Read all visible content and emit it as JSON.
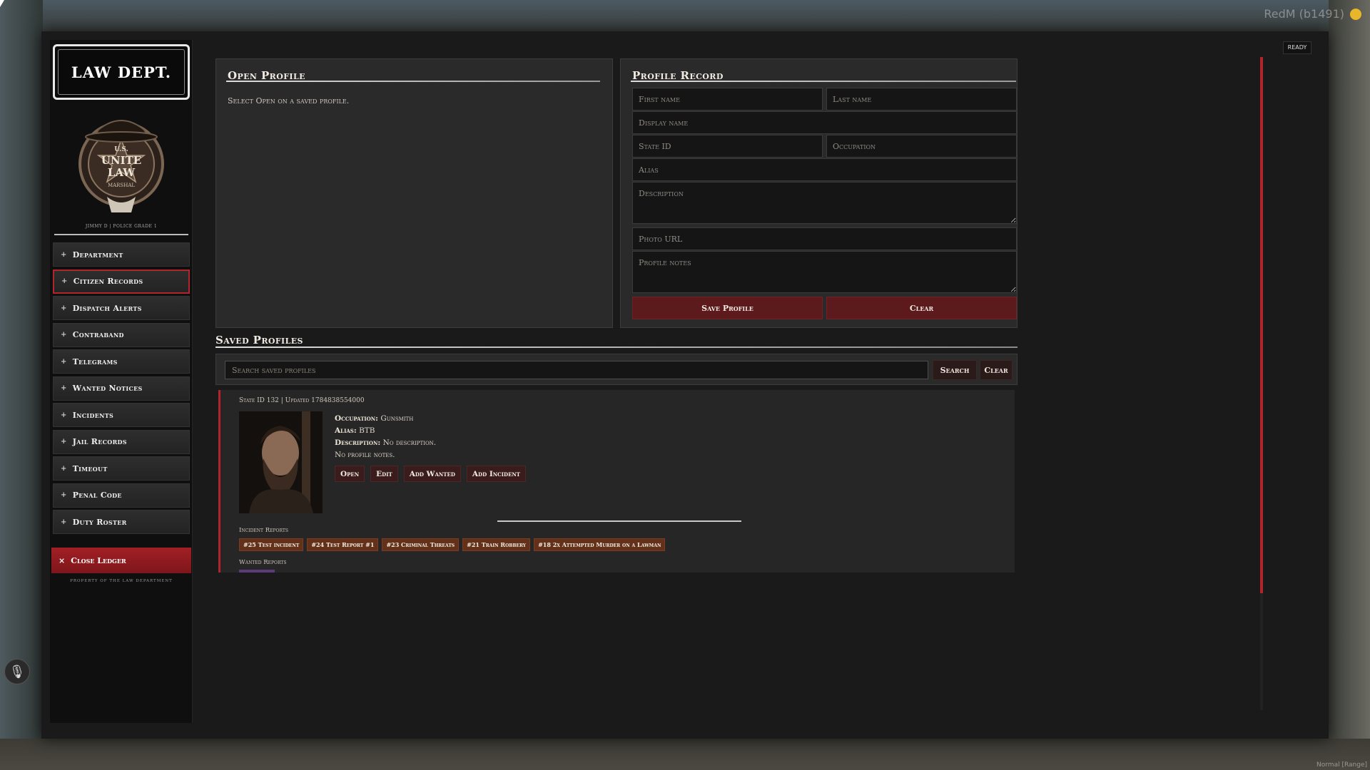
{
  "hud": {
    "top_right": "RedM (b1491)",
    "bottom_right": "Normal [Range]",
    "mic_icon": "microphone-icon"
  },
  "sidebar": {
    "logo": "LAW DEPT.",
    "badge_text": [
      "U.S.",
      "UNITE",
      "LAW",
      "MARSHAL"
    ],
    "user": "Jimmy D | Police Grade 1",
    "nav": [
      {
        "label": "Department",
        "active": false
      },
      {
        "label": "Citizen Records",
        "active": true
      },
      {
        "label": "Dispatch Alerts",
        "active": false
      },
      {
        "label": "Contraband",
        "active": false
      },
      {
        "label": "Telegrams",
        "active": false
      },
      {
        "label": "Wanted Notices",
        "active": false
      },
      {
        "label": "Incidents",
        "active": false
      },
      {
        "label": "Jail Records",
        "active": false
      },
      {
        "label": "Timeout",
        "active": false
      },
      {
        "label": "Penal Code",
        "active": false
      },
      {
        "label": "Duty Roster",
        "active": false
      }
    ],
    "close_label": "Close Ledger",
    "footer": "Property of the Law Department",
    "active_color": "#b3252c"
  },
  "status": {
    "ready": "Ready"
  },
  "open_profile": {
    "title": "Open Profile",
    "hint": "Select Open on a saved profile."
  },
  "profile_record": {
    "title": "Profile Record",
    "fields": {
      "first_name": "First name",
      "last_name": "Last name",
      "display_name": "Display name",
      "state_id": "State ID",
      "occupation": "Occupation",
      "alias": "Alias",
      "description": "Description",
      "photo_url": "Photo URL",
      "profile_notes": "Profile notes"
    },
    "save_label": "Save Profile",
    "clear_label": "Clear"
  },
  "saved_profiles": {
    "title": "Saved Profiles",
    "search_placeholder": "Search saved profiles",
    "search_label": "Search",
    "clear_label": "Clear",
    "card": {
      "meta": "State ID 132 | Updated 1784838554000",
      "occupation_label": "Occupation:",
      "occupation": "Gunsmith",
      "alias_label": "Alias:",
      "alias": "BTB",
      "description_label": "Description:",
      "description": "No description.",
      "notes": "No profile notes.",
      "actions": [
        "Open",
        "Edit",
        "Add Wanted",
        "Add Incident"
      ],
      "incident_heading": "Incident Reports",
      "incidents": [
        "#25 Test incident",
        "#24 Test Report #1",
        "#23 Criminal Threats",
        "#21 Train Robbery",
        "#18 2x Attempted Murder on a Lawman"
      ],
      "wanted_heading": "Wanted Reports"
    }
  }
}
